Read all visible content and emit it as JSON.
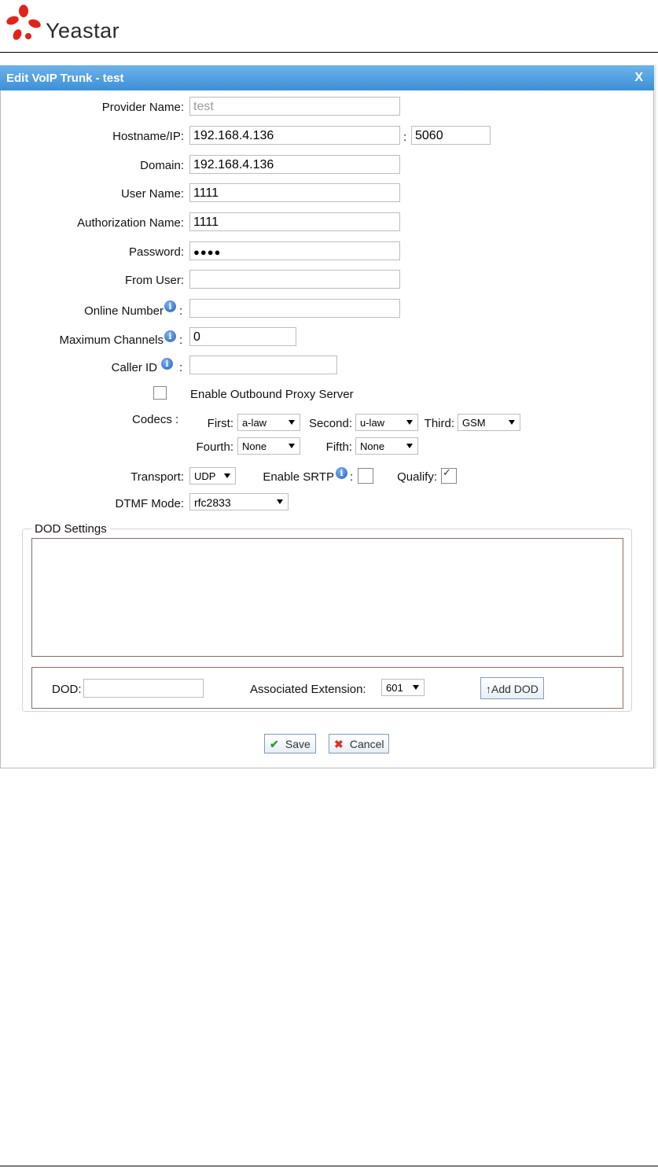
{
  "brand": {
    "name": "Yeastar"
  },
  "dialog": {
    "title": "Edit VoIP Trunk - test",
    "close_label": "X"
  },
  "form": {
    "provider_name": {
      "label": "Provider Name:",
      "value": "test"
    },
    "hostname": {
      "label": "Hostname/IP:",
      "value": "192.168.4.136",
      "port_sep": ":",
      "port": "5060"
    },
    "domain": {
      "label": "Domain:",
      "value": "192.168.4.136"
    },
    "user_name": {
      "label": "User Name:",
      "value": "1111"
    },
    "auth_name": {
      "label": "Authorization Name:",
      "value": "1111"
    },
    "password": {
      "label": "Password:",
      "value": "●●●●"
    },
    "from_user": {
      "label": "From User:",
      "value": ""
    },
    "online_number": {
      "label": "Online Number",
      "suffix": ":",
      "value": ""
    },
    "max_channels": {
      "label": "Maximum Channels",
      "suffix": ":",
      "value": "0"
    },
    "caller_id": {
      "label": "Caller ID",
      "suffix": ":",
      "value": ""
    },
    "outbound_proxy": {
      "label": "Enable Outbound Proxy Server",
      "checked": false
    },
    "codecs": {
      "label": "Codecs :",
      "first": {
        "label": "First:",
        "value": "a-law"
      },
      "second": {
        "label": "Second:",
        "value": "u-law"
      },
      "third": {
        "label": "Third:",
        "value": "GSM"
      },
      "fourth": {
        "label": "Fourth:",
        "value": "None"
      },
      "fifth": {
        "label": "Fifth:",
        "value": "None"
      }
    },
    "transport": {
      "label": "Transport:",
      "value": "UDP"
    },
    "srtp": {
      "label": "Enable SRTP",
      "suffix": ":",
      "checked": false
    },
    "qualify": {
      "label": "Qualify:",
      "checked": true
    },
    "dtmf": {
      "label": "DTMF Mode:",
      "value": "rfc2833"
    }
  },
  "dod": {
    "legend": "DOD Settings",
    "dod_label": "DOD:",
    "dod_value": "",
    "ext_label": "Associated Extension:",
    "ext_value": "601",
    "add_label": "↑Add DOD"
  },
  "actions": {
    "save": "Save",
    "cancel": "Cancel"
  },
  "icons": {
    "info": "info-icon",
    "save": "checkmark-icon",
    "cancel": "x-icon"
  },
  "colors": {
    "title_bar": "#3b8fd8",
    "save_check": "#2e9e2e",
    "cancel_x": "#d9342b"
  }
}
